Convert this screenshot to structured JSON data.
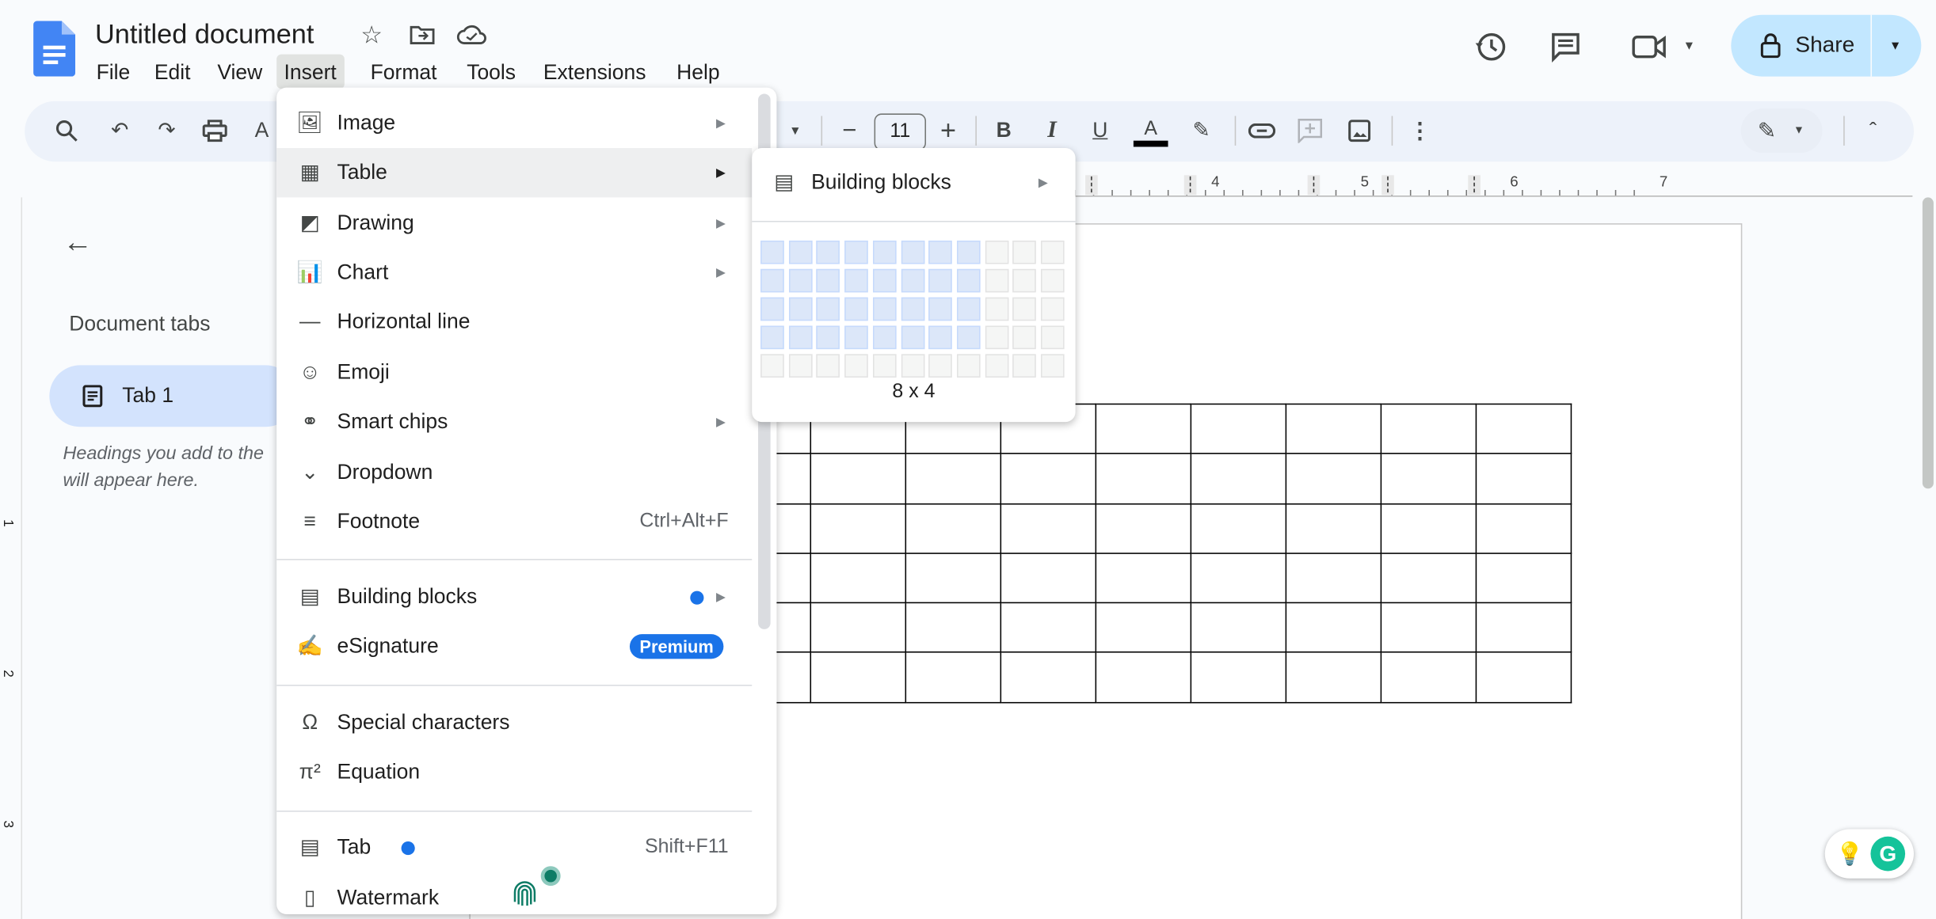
{
  "app": {
    "title": "Untitled document",
    "icons": [
      "star-icon",
      "move-folder-icon",
      "cloud-saved-icon"
    ]
  },
  "menubar": [
    "File",
    "Edit",
    "View",
    "Insert",
    "Format",
    "Tools",
    "Extensions",
    "Help"
  ],
  "header": {
    "share_label": "Share",
    "icons": [
      "version-history-icon",
      "comments-icon",
      "meet-icon",
      "lock-icon"
    ]
  },
  "toolbar": {
    "font_size": "11",
    "minus": "−",
    "plus": "+",
    "bold": "B",
    "italic": "I",
    "underline": "U",
    "text_color": "A",
    "text_color_value": "#000000"
  },
  "ruler": {
    "labels": [
      "4",
      "5",
      "6",
      "7"
    ],
    "vertical_labels": [
      "1",
      "2",
      "3"
    ]
  },
  "sidebar": {
    "heading": "Document tabs",
    "tab": "Tab 1",
    "hint_line1": "Headings you add to the",
    "hint_line2": "will appear here."
  },
  "insert_menu": {
    "items": [
      {
        "label": "Image",
        "icon": "image-icon",
        "submenu": true
      },
      {
        "label": "Table",
        "icon": "table-icon",
        "submenu": true,
        "highlighted": true
      },
      {
        "label": "Drawing",
        "icon": "drawing-icon",
        "submenu": true
      },
      {
        "label": "Chart",
        "icon": "chart-icon",
        "submenu": true
      },
      {
        "label": "Horizontal line",
        "icon": "horizontal-line-icon"
      },
      {
        "label": "Emoji",
        "icon": "emoji-icon"
      },
      {
        "label": "Smart chips",
        "icon": "smart-chips-icon",
        "submenu": true
      },
      {
        "label": "Dropdown",
        "icon": "dropdown-icon"
      },
      {
        "label": "Footnote",
        "icon": "footnote-icon",
        "shortcut": "Ctrl+Alt+F"
      },
      {
        "label": "Building blocks",
        "icon": "building-blocks-icon",
        "submenu": true,
        "new_dot": true
      },
      {
        "label": "eSignature",
        "icon": "esignature-icon",
        "badge": "Premium"
      },
      {
        "label": "Special characters",
        "icon": "omega-icon"
      },
      {
        "label": "Equation",
        "icon": "pi-icon"
      },
      {
        "label": "Tab",
        "icon": "tab-doc-icon",
        "shortcut": "Shift+F11",
        "new_dot": true
      },
      {
        "label": "Watermark",
        "icon": "watermark-icon"
      }
    ]
  },
  "table_submenu": {
    "building_blocks": "Building blocks",
    "grid_cols": 11,
    "grid_rows": 5,
    "selected_cols": 8,
    "selected_rows": 4,
    "size_label": "8 x 4"
  },
  "document": {
    "table_rows": 6,
    "table_cols": 9
  },
  "colors": {
    "accent": "#0b57d0",
    "share_bg": "#c2e7ff",
    "tab_bg": "#d3e3fd",
    "dot": "#1a73e8",
    "premium": "#1a73e8",
    "grammarly": "#15c39a"
  }
}
